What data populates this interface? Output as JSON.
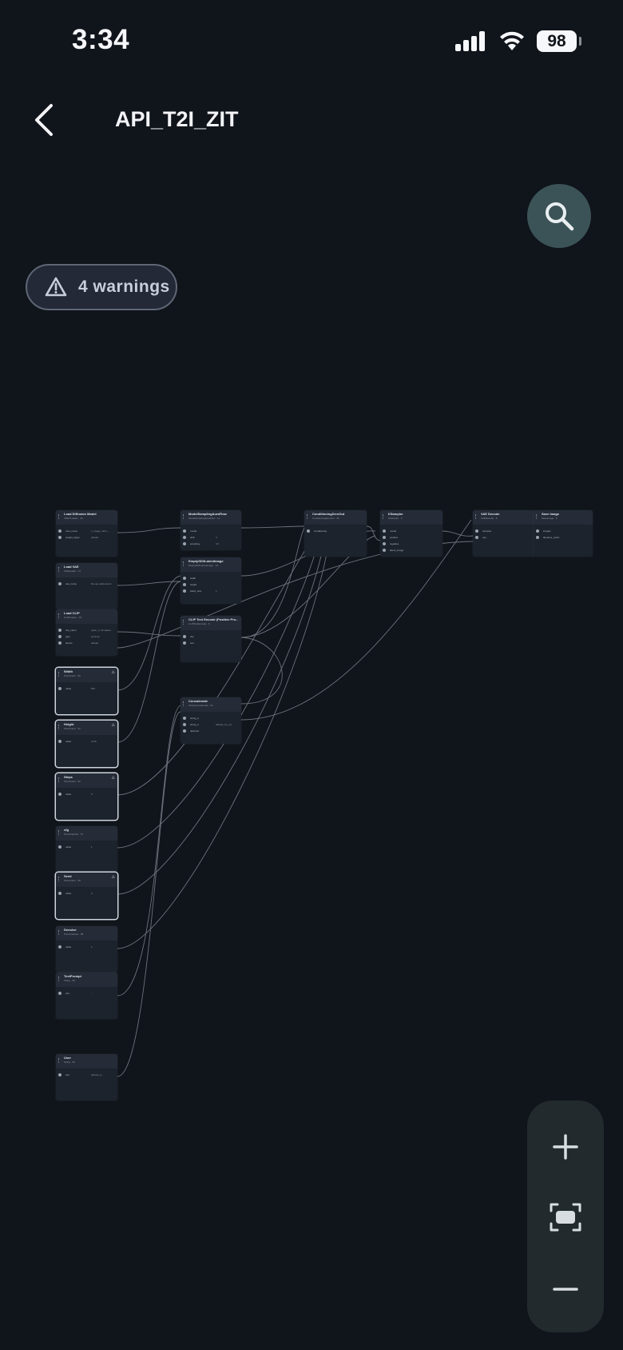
{
  "status_bar": {
    "time": "3:34",
    "battery": "98"
  },
  "header": {
    "title": "API_T2I_ZIT"
  },
  "warnings": {
    "label": "4 warnings"
  },
  "nodes": [
    {
      "id": "load-diffusion",
      "title": "Load Diffusion Model",
      "sub": "UNETLoader · 46",
      "rows": [
        {
          "l": "unet_name",
          "v": "z_image_turbo_..."
        },
        {
          "l": "weight_dtype",
          "v": "default"
        }
      ]
    },
    {
      "id": "load-vae",
      "title": "Load VAE",
      "sub": "VAELoader · 11",
      "rows": [
        {
          "l": "vae_name",
          "v": "flux-ae.safetensors"
        }
      ]
    },
    {
      "id": "load-clip",
      "title": "Load CLIP",
      "sub": "CLIPLoader · 18",
      "rows": [
        {
          "l": "clip_name",
          "v": "qwen_3_4b.safete..."
        },
        {
          "l": "type",
          "v": "lumina2"
        },
        {
          "l": "device",
          "v": "default"
        }
      ]
    },
    {
      "id": "width",
      "title": "Width",
      "sub": "PrimitiveInt · 50",
      "rows": [
        {
          "l": "value",
          "v": "832"
        }
      ]
    },
    {
      "id": "height",
      "title": "Height",
      "sub": "PrimitiveInt · 51",
      "rows": [
        {
          "l": "value",
          "v": "1216"
        }
      ]
    },
    {
      "id": "steps",
      "title": "Steps",
      "sub": "PrimitiveInt · 52",
      "rows": [
        {
          "l": "value",
          "v": "9"
        }
      ]
    },
    {
      "id": "cfg",
      "title": "cfg",
      "sub": "PrimitiveFloat · 57",
      "rows": [
        {
          "l": "value",
          "v": "1"
        }
      ]
    },
    {
      "id": "seed",
      "title": "Seed",
      "sub": "PrimitiveInt · 56",
      "rows": [
        {
          "l": "value",
          "v": "0"
        }
      ]
    },
    {
      "id": "denoise",
      "title": "Denoise",
      "sub": "PrimitiveFloat · 58",
      "rows": [
        {
          "l": "value",
          "v": "1"
        }
      ]
    },
    {
      "id": "textprompt",
      "title": "TextPrompt",
      "sub": "String · 59",
      "rows": [
        {
          "l": "text",
          "v": "..."
        }
      ]
    },
    {
      "id": "user",
      "title": "User",
      "sub": "String · 60",
      "rows": [
        {
          "l": "text",
          "v": "default_pr..."
        }
      ]
    },
    {
      "id": "model-sampling",
      "title": "ModelSamplingAuraFlow",
      "sub": "ModelSamplingAuraFlow · 11",
      "rows": [
        {
          "l": "model",
          "v": ""
        },
        {
          "l": "shift",
          "v": "3"
        },
        {
          "l": "sampling",
          "v": "3.0"
        }
      ]
    },
    {
      "id": "empty-latent",
      "title": "EmptySD3LatentImage",
      "sub": "EmptySD3LatentImage · 13",
      "rows": [
        {
          "l": "width",
          "v": ""
        },
        {
          "l": "height",
          "v": ""
        },
        {
          "l": "batch_size",
          "v": "1"
        }
      ]
    },
    {
      "id": "clip-text",
      "title": "CLIP Text Encode (Positive Pro...",
      "sub": "CLIPTextEncode · 6",
      "rows": [
        {
          "l": "clip",
          "v": ""
        },
        {
          "l": "text",
          "v": ""
        }
      ]
    },
    {
      "id": "concatenate",
      "title": "Concatenate",
      "sub": "StringConcatenate · 61",
      "rows": [
        {
          "l": "string_a",
          "v": ""
        },
        {
          "l": "string_b",
          "v": "default_res_sh..."
        },
        {
          "l": "delimiter",
          "v": ","
        }
      ]
    },
    {
      "id": "cond-zeroout",
      "title": "ConditioningZeroOut",
      "sub": "ConditioningZeroOut · 42",
      "rows": [
        {
          "l": "conditioning",
          "v": ""
        }
      ]
    },
    {
      "id": "ksampler",
      "title": "KSampler",
      "sub": "KSampler · 3",
      "rows": [
        {
          "l": "model",
          "v": ""
        },
        {
          "l": "positive",
          "v": ""
        },
        {
          "l": "negative",
          "v": ""
        },
        {
          "l": "latent_image",
          "v": ""
        }
      ]
    },
    {
      "id": "vae-decode",
      "title": "VAE Decode",
      "sub": "VAEDecode · 8",
      "rows": [
        {
          "l": "samples",
          "v": ""
        },
        {
          "l": "vae",
          "v": ""
        }
      ]
    },
    {
      "id": "save-image",
      "title": "Save Image",
      "sub": "SaveImage · 9",
      "rows": [
        {
          "l": "images",
          "v": ""
        },
        {
          "l": "filename_prefix",
          "v": ""
        }
      ]
    }
  ],
  "zoom": {
    "in_icon": "plus-icon",
    "fit_icon": "fit-screen-icon",
    "out_icon": "minus-icon"
  }
}
